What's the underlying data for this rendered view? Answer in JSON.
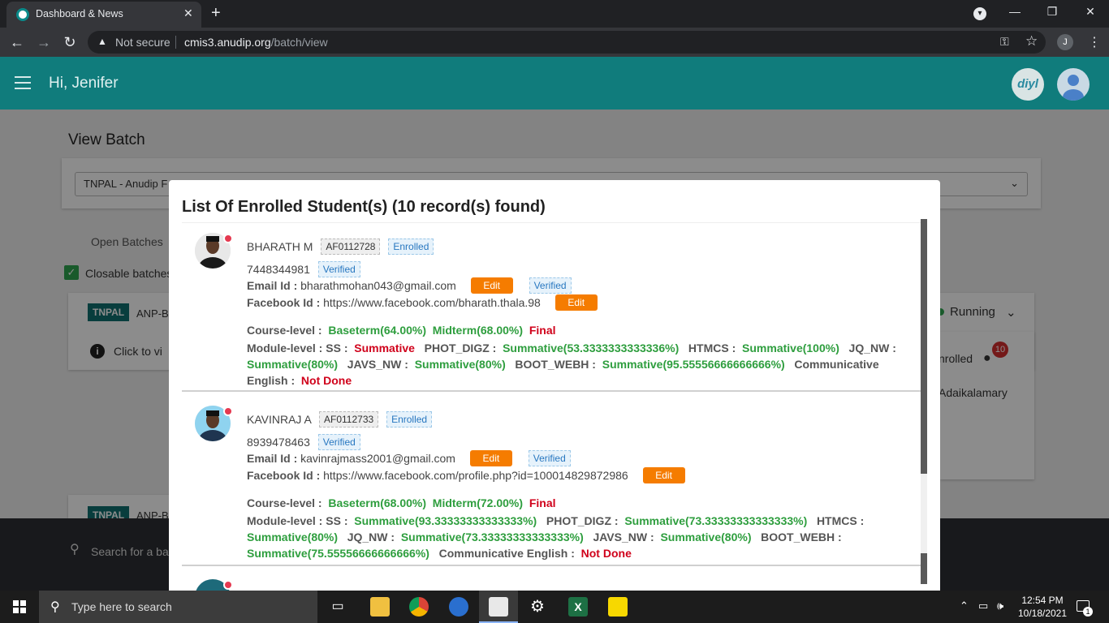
{
  "browser": {
    "tab_title": "Dashboard & News",
    "not_secure": "Not secure",
    "url_host": "cmis3.anudip.org",
    "url_path": "/batch/view",
    "profile_initial": "J"
  },
  "app": {
    "greeting": "Hi, Jenifer",
    "logo_text": "diyl"
  },
  "page": {
    "title": "View Batch",
    "batch_select_value": "TNPAL - Anudip F",
    "tab_open_batches": "Open Batches",
    "closable_label": "Closable batches",
    "card1_org": "TNPAL",
    "card1_code": "ANP-B",
    "card1_click": "Click to vi",
    "card1_status": "Running",
    "card1_enrolled": "nrolled",
    "card1_enrolled_count": "10",
    "card1_trainer": "Adaikalamary",
    "card2_org": "TNPAL",
    "card2_code": "ANP-B",
    "search_placeholder": "Search for a bat"
  },
  "modal": {
    "title": "List Of Enrolled Student(s) (10 record(s) found)",
    "labels": {
      "email": "Email Id :",
      "facebook": "Facebook Id :",
      "course_level": "Course-level :",
      "module_level": "Module-level :",
      "edit": "Edit",
      "verified": "Verified",
      "enrolled": "Enrolled"
    },
    "students": [
      {
        "name": "BHARATH M",
        "id": "AF0112728",
        "status": "Enrolled",
        "phone": "7448344981",
        "phone_status": "Verified",
        "email": "bharathmohan043@gmail.com",
        "email_status": "Verified",
        "facebook": "https://www.facebook.com/bharath.thala.98",
        "course": [
          "Baseterm(64.00%)",
          "Midterm(68.00%)",
          "Final"
        ],
        "modules": {
          "SS": "Summative",
          "PHOT_DIGZ": "Summative(53.3333333333336%)",
          "HTMCS": "Summative(100%)",
          "JQ_NW": "Summative(80%)",
          "JAVS_NW": "Summative(80%)",
          "BOOT_WEBH": "Summative(95.55556666666666%)",
          "Communicative English": "Not Done"
        }
      },
      {
        "name": "KAVINRAJ A",
        "id": "AF0112733",
        "status": "Enrolled",
        "phone": "8939478463",
        "phone_status": "Verified",
        "email": "kavinrajmass2001@gmail.com",
        "email_status": "Verified",
        "facebook": "https://www.facebook.com/profile.php?id=100014829872986",
        "course": [
          "Baseterm(68.00%)",
          "Midterm(72.00%)",
          "Final"
        ],
        "modules": {
          "SS": "Summative(93.33333333333333%)",
          "PHOT_DIGZ": "Summative(73.33333333333333%)",
          "HTMCS": "Summative(80%)",
          "JQ_NW": "Summative(73.33333333333333%)",
          "JAVS_NW": "Summative(80%)",
          "BOOT_WEBH": "Summative(75.55556666666666%)",
          "Communicative English": "Not Done"
        }
      }
    ]
  },
  "taskbar": {
    "search_placeholder": "Type here to search",
    "time": "12:54 PM",
    "date": "10/18/2021",
    "notif_count": "1"
  }
}
